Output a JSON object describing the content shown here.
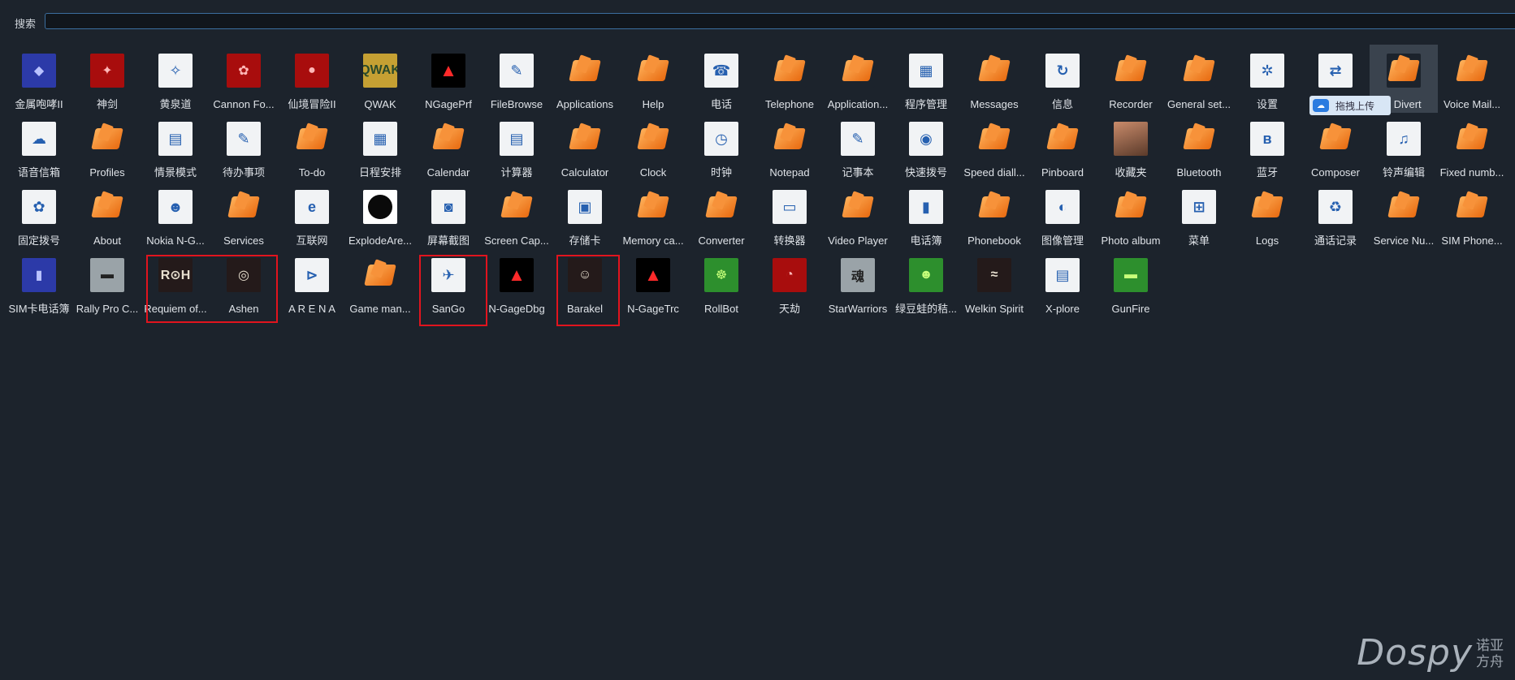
{
  "search": {
    "label": "搜索",
    "value": "",
    "placeholder": ""
  },
  "icons": [
    {
      "label": "金属咆哮II",
      "style": "i-blue",
      "glyph": "◆"
    },
    {
      "label": "神剑",
      "style": "i-red",
      "glyph": "✦"
    },
    {
      "label": "黄泉道",
      "style": "i-white",
      "glyph": "✧"
    },
    {
      "label": "Cannon Fo...",
      "style": "i-red",
      "glyph": "✿"
    },
    {
      "label": "仙境冒险II",
      "style": "i-red",
      "glyph": "●"
    },
    {
      "label": "QWAK",
      "style": "i-yellow",
      "glyph": "QWAK"
    },
    {
      "label": "NGagePrf",
      "style": "i-black",
      "glyph": "▲"
    },
    {
      "label": "FileBrowse",
      "style": "i-white",
      "glyph": "✎"
    },
    {
      "label": "Applications",
      "style": "i-orange",
      "glyph": ""
    },
    {
      "label": "Help",
      "style": "i-orange",
      "glyph": ""
    },
    {
      "label": "电话",
      "style": "i-white",
      "glyph": "☎"
    },
    {
      "label": "Telephone",
      "style": "i-orange",
      "glyph": ""
    },
    {
      "label": "Application...",
      "style": "i-orange",
      "glyph": ""
    },
    {
      "label": "程序管理",
      "style": "i-white",
      "glyph": "▦"
    },
    {
      "label": "Messages",
      "style": "i-orange",
      "glyph": ""
    },
    {
      "label": "信息",
      "style": "i-white",
      "glyph": "↻"
    },
    {
      "label": "Recorder",
      "style": "i-orange",
      "glyph": ""
    },
    {
      "label": "General set...",
      "style": "i-orange",
      "glyph": ""
    },
    {
      "label": "设置",
      "style": "i-white",
      "glyph": "✲"
    },
    {
      "label": "",
      "style": "i-white",
      "glyph": "⇄"
    },
    {
      "label": "ll Divert",
      "style": "i-orange",
      "glyph": ""
    },
    {
      "label": "Voice Mail...",
      "style": "i-orange",
      "glyph": ""
    },
    {
      "label": "语音信箱",
      "style": "i-white",
      "glyph": "☁"
    },
    {
      "label": "Profiles",
      "style": "i-orange",
      "glyph": ""
    },
    {
      "label": "情景模式",
      "style": "i-white",
      "glyph": "▤"
    },
    {
      "label": "待办事项",
      "style": "i-white",
      "glyph": "✎"
    },
    {
      "label": "To-do",
      "style": "i-orange",
      "glyph": ""
    },
    {
      "label": "日程安排",
      "style": "i-white",
      "glyph": "▦"
    },
    {
      "label": "Calendar",
      "style": "i-orange",
      "glyph": ""
    },
    {
      "label": "计算器",
      "style": "i-white",
      "glyph": "▤"
    },
    {
      "label": "Calculator",
      "style": "i-orange",
      "glyph": ""
    },
    {
      "label": "Clock",
      "style": "i-orange",
      "glyph": ""
    },
    {
      "label": "时钟",
      "style": "i-white",
      "glyph": "◷"
    },
    {
      "label": "Notepad",
      "style": "i-orange",
      "glyph": ""
    },
    {
      "label": "记事本",
      "style": "i-white",
      "glyph": "✎"
    },
    {
      "label": "快速拨号",
      "style": "i-white",
      "glyph": "◉"
    },
    {
      "label": "Speed diall...",
      "style": "i-orange",
      "glyph": ""
    },
    {
      "label": "Pinboard",
      "style": "i-orange",
      "glyph": ""
    },
    {
      "label": "收藏夹",
      "style": "i-photo",
      "glyph": ""
    },
    {
      "label": "Bluetooth",
      "style": "i-orange",
      "glyph": ""
    },
    {
      "label": "蓝牙",
      "style": "i-white",
      "glyph": "ʙ"
    },
    {
      "label": "Composer",
      "style": "i-orange",
      "glyph": ""
    },
    {
      "label": "铃声编辑",
      "style": "i-white",
      "glyph": "♫"
    },
    {
      "label": "Fixed numb...",
      "style": "i-orange",
      "glyph": ""
    },
    {
      "label": "固定拨号",
      "style": "i-white",
      "glyph": "✿"
    },
    {
      "label": "About",
      "style": "i-orange",
      "glyph": ""
    },
    {
      "label": "Nokia N-G...",
      "style": "i-white",
      "glyph": "☻"
    },
    {
      "label": "Services",
      "style": "i-orange",
      "glyph": ""
    },
    {
      "label": "互联网",
      "style": "i-white",
      "glyph": "e"
    },
    {
      "label": "ExplodeAre...",
      "style": "i-bomb",
      "glyph": ""
    },
    {
      "label": "屏幕截图",
      "style": "i-white",
      "glyph": "◙"
    },
    {
      "label": "Screen Cap...",
      "style": "i-orange",
      "glyph": ""
    },
    {
      "label": "存储卡",
      "style": "i-white",
      "glyph": "▣"
    },
    {
      "label": "Memory ca...",
      "style": "i-orange",
      "glyph": ""
    },
    {
      "label": "Converter",
      "style": "i-orange",
      "glyph": ""
    },
    {
      "label": "转换器",
      "style": "i-white",
      "glyph": "▭"
    },
    {
      "label": "Video Player",
      "style": "i-orange",
      "glyph": ""
    },
    {
      "label": "电话簿",
      "style": "i-white",
      "glyph": "▮"
    },
    {
      "label": "Phonebook",
      "style": "i-orange",
      "glyph": ""
    },
    {
      "label": "图像管理",
      "style": "i-white",
      "glyph": "◐"
    },
    {
      "label": "Photo album",
      "style": "i-orange",
      "glyph": ""
    },
    {
      "label": "菜单",
      "style": "i-white",
      "glyph": "⊞"
    },
    {
      "label": "Logs",
      "style": "i-orange",
      "glyph": ""
    },
    {
      "label": "通话记录",
      "style": "i-white",
      "glyph": "♻"
    },
    {
      "label": "Service Nu...",
      "style": "i-orange",
      "glyph": ""
    },
    {
      "label": "SIM Phone...",
      "style": "i-orange",
      "glyph": ""
    },
    {
      "label": "SIM卡电话簿",
      "style": "i-blue",
      "glyph": "▮"
    },
    {
      "label": "Rally Pro C...",
      "style": "i-gray",
      "glyph": "▬"
    },
    {
      "label": "Requiem of...",
      "style": "i-dark",
      "glyph": "R⊙H"
    },
    {
      "label": "Ashen",
      "style": "i-dark",
      "glyph": "◎"
    },
    {
      "label": "A R E N A",
      "style": "i-white",
      "glyph": "⊳"
    },
    {
      "label": "Game man...",
      "style": "i-orange",
      "glyph": ""
    },
    {
      "label": "SanGo",
      "style": "i-white",
      "glyph": "✈"
    },
    {
      "label": "N-GageDbg",
      "style": "i-black",
      "glyph": "▲"
    },
    {
      "label": "Barakel",
      "style": "i-dark",
      "glyph": "☺"
    },
    {
      "label": "N-GageTrc",
      "style": "i-black",
      "glyph": "▲"
    },
    {
      "label": "RollBot",
      "style": "i-green",
      "glyph": "☸"
    },
    {
      "label": "天劫",
      "style": "i-red",
      "glyph": "◔"
    },
    {
      "label": "StarWarriors",
      "style": "i-gray",
      "glyph": "魂"
    },
    {
      "label": "绿豆蛙的秸...",
      "style": "i-green",
      "glyph": "☻"
    },
    {
      "label": "Welkin Spirit",
      "style": "i-dark",
      "glyph": "≈"
    },
    {
      "label": "X-plore",
      "style": "i-white",
      "glyph": "▤"
    },
    {
      "label": "GunFire",
      "style": "i-green",
      "glyph": "▬"
    }
  ],
  "tooltip": {
    "text": "拖拽上传",
    "icon": "cloud-upload-icon"
  },
  "watermark": {
    "brand": "Dospy",
    "sub": "诺亚方舟"
  },
  "colors": {
    "background": "#1c232c",
    "highlight_box": "#e1141e",
    "accent_orange": "#f07d1e",
    "search_border": "#3b6e9e"
  }
}
